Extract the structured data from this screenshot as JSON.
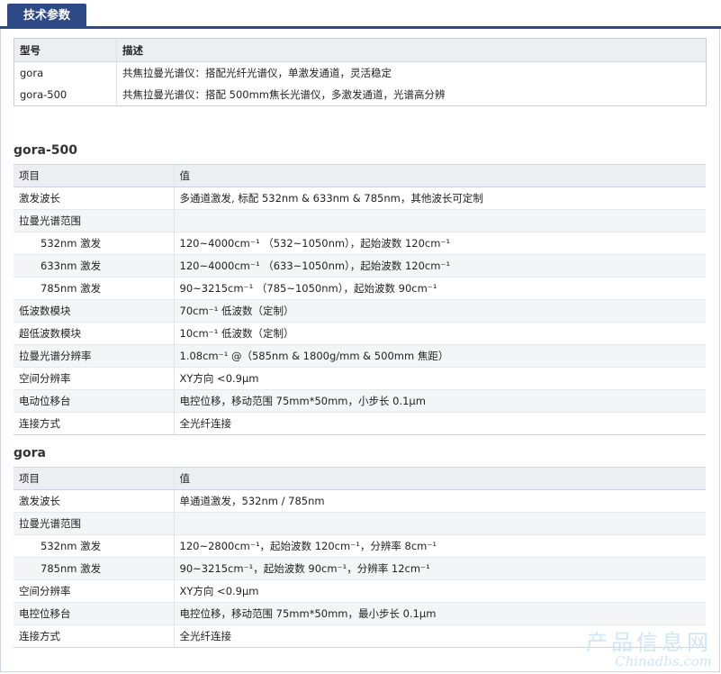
{
  "tab": {
    "label": "技术参数"
  },
  "models": {
    "headers": [
      "型号",
      "描述"
    ],
    "rows": [
      [
        "gora",
        "共焦拉曼光谱仪：搭配光纤光谱仪，单激发通道，灵活稳定"
      ],
      [
        "gora-500",
        "共焦拉曼光谱仪：搭配 500mm焦长光谱仪，多激发通道，光谱高分辨"
      ]
    ]
  },
  "sections": [
    {
      "title": "gora-500",
      "headers": [
        "项目",
        "值"
      ],
      "rows": [
        [
          "激发波长",
          "多通道激发, 标配 532nm & 633nm & 785nm，其他波长可定制"
        ],
        [
          "拉曼光谱范围",
          ""
        ],
        [
          "532nm 激发",
          "120~4000cm⁻¹ （532~1050nm），起始波数 120cm⁻¹"
        ],
        [
          "633nm 激发",
          "120~4000cm⁻¹ （633~1050nm），起始波数 120cm⁻¹"
        ],
        [
          "785nm 激发",
          "90~3215cm⁻¹ （785~1050nm），起始波数 90cm⁻¹"
        ],
        [
          "低波数模块",
          "70cm⁻¹ 低波数（定制）"
        ],
        [
          "超低波数模块",
          "10cm⁻¹ 低波数（定制）"
        ],
        [
          "拉曼光谱分辨率",
          "1.08cm⁻¹ @（585nm & 1800g/mm & 500mm 焦距）"
        ],
        [
          "空间分辨率",
          "XY方向 <0.9μm"
        ],
        [
          "电动位移台",
          "电控位移，移动范围 75mm*50mm，小步长 0.1μm"
        ],
        [
          "连接方式",
          "全光纤连接"
        ]
      ]
    },
    {
      "title": "gora",
      "headers": [
        "项目",
        "值"
      ],
      "rows": [
        [
          "激发波长",
          "单通道激发，532nm / 785nm"
        ],
        [
          "拉曼光谱范围",
          ""
        ],
        [
          "532nm 激发",
          "120~2800cm⁻¹，起始波数 120cm⁻¹，分辨率 8cm⁻¹"
        ],
        [
          "785nm 激发",
          "90~3215cm⁻¹，起始波数 90cm⁻¹，分辨率 12cm⁻¹"
        ],
        [
          "空间分辨率",
          "XY方向 <0.9μm"
        ],
        [
          "电控位移台",
          "电控位移，移动范围 75mm*50mm，最小步长 0.1μm"
        ],
        [
          "连接方式",
          "全光纤连接"
        ]
      ]
    }
  ],
  "watermark": {
    "cn": "产品信息网",
    "en": "Chinadbs.com"
  }
}
